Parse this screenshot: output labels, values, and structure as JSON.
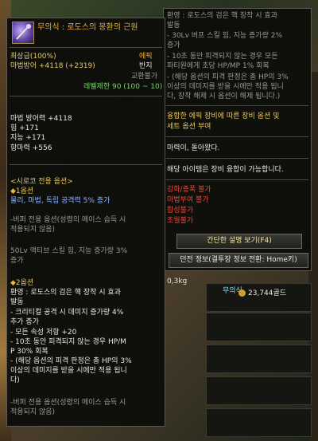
{
  "item": {
    "icon": "weapon-staff-icon",
    "name": "무의식 : 로도스의 몽환의 근원",
    "grade": "최상급(100%)",
    "rarity": "에픽",
    "main_stat": "마법방어 +4118 (+2319)",
    "slot_type": "반지",
    "trade": "교환불가",
    "level_limit": "레벨제한 90 (100 ~ 10)",
    "stats": [
      "마법 방어력 +4118",
      "힘 +171",
      "지능 +171",
      "항마력 +556"
    ],
    "exclusive_header": "<시로코 전용 옵션>",
    "option1_header": "1옵션",
    "option1_line1": "물리, 마법, 독립 공격력 5% 증가",
    "buff_note_a1": "-버퍼 전용 옵션(성령의 메이스 습득 시",
    "buff_note_a2": "적용되지 않음)",
    "option1_line2a": "50Lv 액티브 스킬 힘, 지능 증가량 3%",
    "option1_line2b": "증가",
    "option2_header": "2옵션",
    "option2_lines": [
      "환영 : 로도스의 검은 핵 장착 시 효과",
      "발동",
      "- 크리티컬 공격 시 데미지 증가량 4%",
      "추가 증가",
      "- 모든 속성 저항 +20",
      "- 10초 동안 피격되지 않는 경우 HP/M",
      "P 30% 회복",
      "- (해당 옵션의 피격 판정은 총 HP의 3%",
      "이상의 데미지를 받을 시에만 적용 됩니",
      "다)"
    ],
    "buff_note_b1": "-버퍼 전용 옵션(성령의 메이스 습득 시",
    "buff_note_b2": "적용되지 않음)"
  },
  "tooltip2": {
    "lines": [
      "환영 : 로도스의 검은 핵 장착 시 효과",
      "발동",
      "- 30Lv 버프 스킬 힘, 지능 증가량 2%",
      "증가",
      "- 10초 동안 피격되지 않는 경우 모든",
      "파티원에게 초당 HP/MP 1% 회복",
      "- (해당 옵션의 피격 판정은 총 HP의 3%",
      "이상의 데미지를 받을 시에만 적용 됩니",
      "다, 장착 해제 시 옵션이 해제 됩니다.)"
    ],
    "fusion1": "융합한 에픽 장비에 따른 장비 옵션 및",
    "fusion2": "세트 옵션 부여",
    "flavor": "마력이, 돌아왔다.",
    "fusible": "해당 아이템은 장비 융합이 가능합니다.",
    "restrictions": [
      "강화/증폭 불가",
      "마법부여 불가",
      "합성불가",
      "초월불가"
    ],
    "brief_button": "간단한 설명 보기(F4)",
    "durability_info": "던전 정보(결투장 정보 전환: Home키)",
    "weight": "0,3kg"
  },
  "inventory": {
    "gold": "23,744골드",
    "item_label": "무의식"
  }
}
